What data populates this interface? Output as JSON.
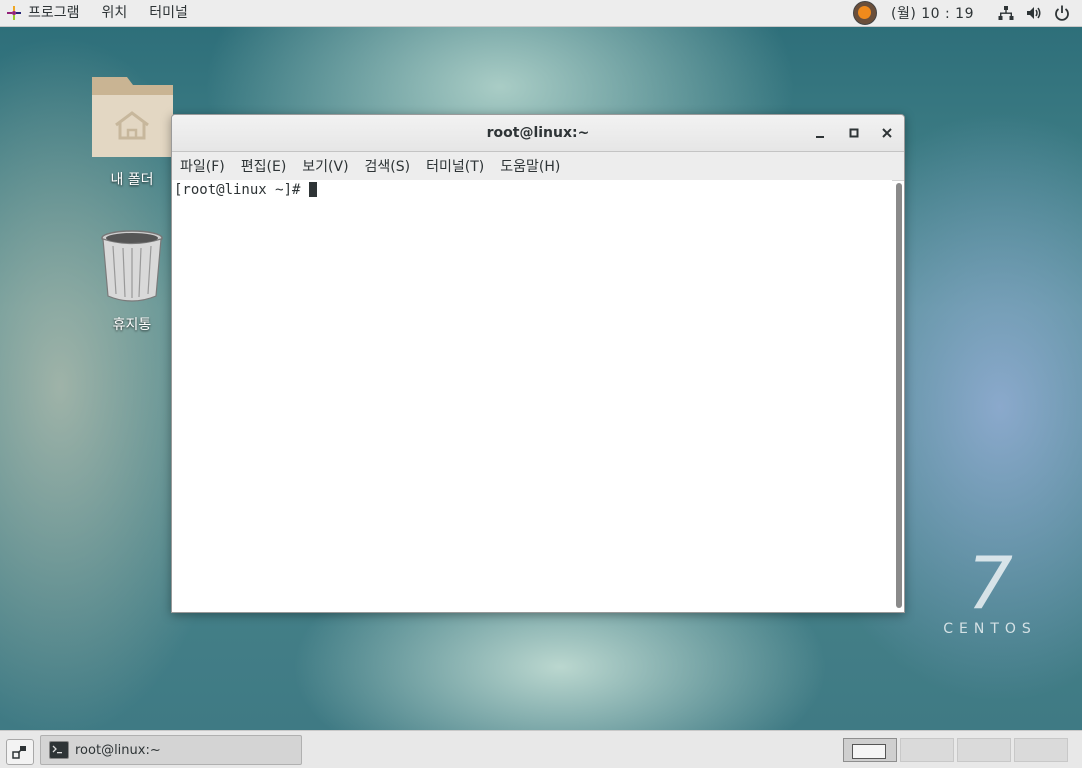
{
  "topbar": {
    "menu": [
      {
        "label": "프로그램"
      },
      {
        "label": "위치"
      },
      {
        "label": "터미널"
      }
    ],
    "clock": "(월) 10 : 19"
  },
  "desktop": {
    "icons": [
      {
        "label": "내 폴더",
        "icon": "home-folder-icon"
      },
      {
        "label": "휴지통",
        "icon": "trash-icon"
      }
    ],
    "branding": {
      "number": "7",
      "name": "CENTOS"
    }
  },
  "terminal": {
    "title": "root@linux:~",
    "menu": [
      {
        "label": "파일(F)"
      },
      {
        "label": "편집(E)"
      },
      {
        "label": "보기(V)"
      },
      {
        "label": "검색(S)"
      },
      {
        "label": "터미널(T)"
      },
      {
        "label": "도움말(H)"
      }
    ],
    "prompt": "[root@linux ~]# "
  },
  "taskbar": {
    "window_button": "root@linux:~",
    "workspaces": 4,
    "active_workspace": 1
  }
}
